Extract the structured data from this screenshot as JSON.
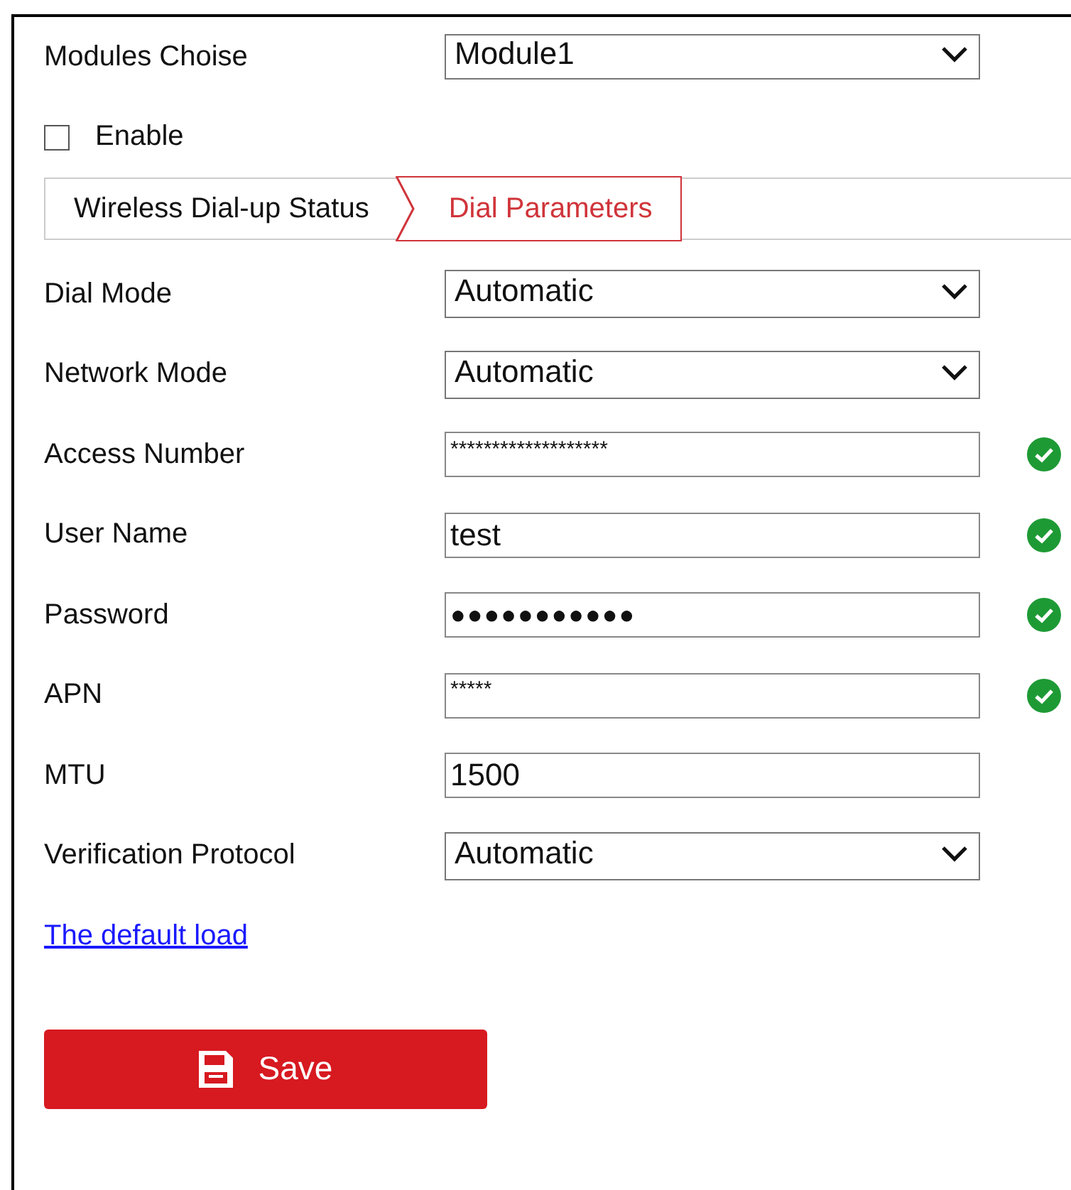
{
  "module": {
    "label": "Modules Choise",
    "value": "Module1"
  },
  "enable": {
    "label": "Enable",
    "checked": false
  },
  "tabs": [
    {
      "label": "Wireless Dial-up Status",
      "selected": false
    },
    {
      "label": "Dial Parameters",
      "selected": true
    }
  ],
  "fields": [
    {
      "kind": "select",
      "label": "Dial Mode",
      "value": "Automatic",
      "valid": false
    },
    {
      "kind": "select",
      "label": "Network Mode",
      "value": "Automatic",
      "valid": false
    },
    {
      "kind": "masked",
      "label": "Access Number",
      "value": "*******************",
      "valid": true
    },
    {
      "kind": "text",
      "label": "User Name",
      "value": "test",
      "valid": true
    },
    {
      "kind": "password",
      "label": "Password",
      "value": "●●●●●●●●●●●",
      "valid": true
    },
    {
      "kind": "masked",
      "label": "APN",
      "value": "*****",
      "valid": true
    },
    {
      "kind": "text",
      "label": "MTU",
      "value": "1500",
      "valid": false
    },
    {
      "kind": "select",
      "label": "Verification Protocol",
      "value": "Automatic",
      "valid": false
    }
  ],
  "default_link": "The default load",
  "save_button": "Save"
}
